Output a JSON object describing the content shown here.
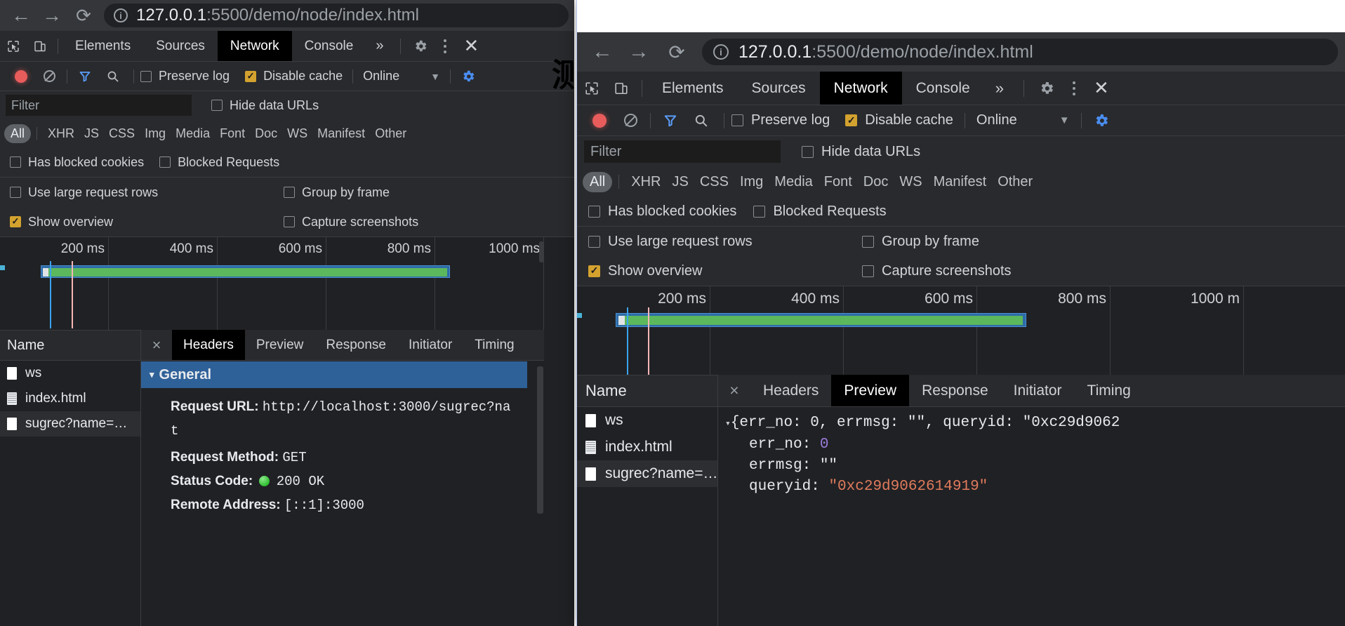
{
  "left_window": {
    "omnibox": {
      "host": "127.0.0.1",
      "path": ":5500/demo/node/index.html",
      "info_icon": "info-icon"
    },
    "nav": {
      "back": "←",
      "forward": "→",
      "reload": "⟳"
    },
    "devtools_tabs": [
      {
        "label": "Elements",
        "active": false
      },
      {
        "label": "Sources",
        "active": false
      },
      {
        "label": "Network",
        "active": true
      },
      {
        "label": "Console",
        "active": false
      },
      {
        "label": "»",
        "active": false
      }
    ],
    "network_toolbar": {
      "record": "record-icon",
      "clear": "clear-icon",
      "filter": "funnel-icon",
      "search": "search-icon",
      "preserve_log": "Preserve log",
      "preserve_log_checked": false,
      "disable_cache": "Disable cache",
      "disable_cache_checked": true,
      "throttling": "Online",
      "settings": "gear-icon",
      "more": "kebab-icon",
      "close": "close-icon"
    },
    "filter_row": {
      "placeholder": "Filter",
      "value": "",
      "hide_data_urls": "Hide data URLs",
      "hide_data_urls_checked": false
    },
    "type_filters": [
      {
        "label": "All",
        "active": true
      },
      {
        "label": "XHR",
        "active": false
      },
      {
        "label": "JS",
        "active": false
      },
      {
        "label": "CSS",
        "active": false
      },
      {
        "label": "Img",
        "active": false
      },
      {
        "label": "Media",
        "active": false
      },
      {
        "label": "Font",
        "active": false
      },
      {
        "label": "Doc",
        "active": false
      },
      {
        "label": "WS",
        "active": false
      },
      {
        "label": "Manifest",
        "active": false
      },
      {
        "label": "Other",
        "active": false
      }
    ],
    "block_row": [
      {
        "label": "Has blocked cookies",
        "checked": false
      },
      {
        "label": "Blocked Requests",
        "checked": false
      }
    ],
    "options_rows": [
      {
        "label": "Use large request rows",
        "checked": false
      },
      {
        "label": "Group by frame",
        "checked": false
      },
      {
        "label": "Show overview",
        "checked": true
      },
      {
        "label": "Capture screenshots",
        "checked": false
      }
    ],
    "overview": {
      "ticks": [
        "200 ms",
        "400 ms",
        "600 ms",
        "800 ms",
        "1000 ms"
      ]
    },
    "request_list": {
      "column_header": "Name",
      "rows": [
        {
          "name": "ws",
          "icon": "ws-icon",
          "selected": false
        },
        {
          "name": "index.html",
          "icon": "document-icon",
          "selected": false
        },
        {
          "name": "sugrec?name=…",
          "icon": "xhr-icon",
          "selected": true
        }
      ]
    },
    "detail": {
      "close": "×",
      "tabs": [
        {
          "label": "Headers",
          "active": true
        },
        {
          "label": "Preview",
          "active": false
        },
        {
          "label": "Response",
          "active": false
        },
        {
          "label": "Initiator",
          "active": false
        },
        {
          "label": "Timing",
          "active": false
        }
      ],
      "section_title": "General",
      "section_arrow": "▾",
      "items": [
        {
          "key": "Request URL:",
          "value": "http://localhost:3000/sugrec?na"
        },
        {
          "key": "",
          "value": "t"
        },
        {
          "key": "Request Method:",
          "value": "GET"
        },
        {
          "key": "Status Code:",
          "value": "200 OK",
          "status_dot": true
        },
        {
          "key": "Remote Address:",
          "value": "[::1]:3000"
        }
      ]
    }
  },
  "right_window": {
    "omnibox": {
      "host": "127.0.0.1",
      "path": ":5500/demo/node/index.html",
      "info_icon": "info-icon"
    },
    "nav": {
      "back": "←",
      "forward": "→",
      "reload": "⟳"
    },
    "devtools_tabs": [
      {
        "label": "Elements",
        "active": false
      },
      {
        "label": "Sources",
        "active": false
      },
      {
        "label": "Network",
        "active": true
      },
      {
        "label": "Console",
        "active": false
      },
      {
        "label": "»",
        "active": false
      }
    ],
    "network_toolbar": {
      "preserve_log": "Preserve log",
      "preserve_log_checked": false,
      "disable_cache": "Disable cache",
      "disable_cache_checked": true,
      "throttling": "Online"
    },
    "filter_row": {
      "placeholder": "Filter",
      "value": "",
      "hide_data_urls": "Hide data URLs",
      "hide_data_urls_checked": false
    },
    "type_filters": [
      {
        "label": "All",
        "active": true
      },
      {
        "label": "XHR",
        "active": false
      },
      {
        "label": "JS",
        "active": false
      },
      {
        "label": "CSS",
        "active": false
      },
      {
        "label": "Img",
        "active": false
      },
      {
        "label": "Media",
        "active": false
      },
      {
        "label": "Font",
        "active": false
      },
      {
        "label": "Doc",
        "active": false
      },
      {
        "label": "WS",
        "active": false
      },
      {
        "label": "Manifest",
        "active": false
      },
      {
        "label": "Other",
        "active": false
      }
    ],
    "block_row": [
      {
        "label": "Has blocked cookies",
        "checked": false
      },
      {
        "label": "Blocked Requests",
        "checked": false
      }
    ],
    "options_rows": [
      {
        "label": "Use large request rows",
        "checked": false
      },
      {
        "label": "Group by frame",
        "checked": false
      },
      {
        "label": "Show overview",
        "checked": true
      },
      {
        "label": "Capture screenshots",
        "checked": false
      }
    ],
    "overview": {
      "ticks": [
        "200 ms",
        "400 ms",
        "600 ms",
        "800 ms",
        "1000 m"
      ]
    },
    "request_list": {
      "column_header": "Name",
      "rows": [
        {
          "name": "ws",
          "icon": "ws-icon",
          "selected": false
        },
        {
          "name": "index.html",
          "icon": "document-icon",
          "selected": false
        },
        {
          "name": "sugrec?name=…",
          "icon": "xhr-icon",
          "selected": true
        }
      ]
    },
    "detail": {
      "close": "×",
      "tabs": [
        {
          "label": "Headers",
          "active": false
        },
        {
          "label": "Preview",
          "active": true
        },
        {
          "label": "Response",
          "active": false
        },
        {
          "label": "Initiator",
          "active": false
        },
        {
          "label": "Timing",
          "active": false
        }
      ],
      "preview_json": {
        "root_arrow": "▾",
        "root_summary_prefix": "{err_no: ",
        "root_summary": "{err_no: 0, errmsg: \"\", queryid: \"0xc29d9062",
        "rows": [
          {
            "key": "err_no:",
            "value": "0",
            "type": "number"
          },
          {
            "key": "errmsg:",
            "value": "\"\"",
            "type": "string"
          },
          {
            "key": "queryid:",
            "value": "\"0xc29d9062614919\"",
            "type": "string"
          }
        ]
      }
    }
  },
  "overlay": {
    "cjk_glyph": "测",
    "colors": {
      "accent_blue": "#2f6199",
      "active_tab_bg": "#000000",
      "checkbox_on": "#d3a22f",
      "timeline_green": "#5cb85c",
      "timeline_blue": "#2d6ca8",
      "status_green": "#2fbf2f",
      "json_number": "#9a7bdc",
      "json_string": "#e07b5c"
    }
  }
}
